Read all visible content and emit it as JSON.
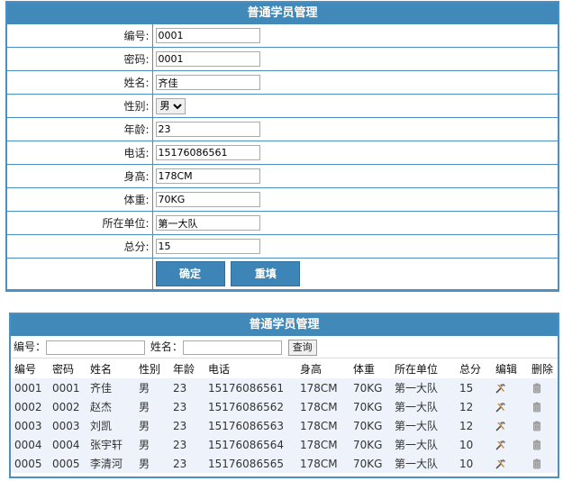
{
  "form": {
    "title": "普通学员管理",
    "fields": [
      {
        "label": "编号:",
        "value": "0001"
      },
      {
        "label": "密码:",
        "value": "0001"
      },
      {
        "label": "姓名:",
        "value": "齐佳"
      },
      {
        "label": "性别:",
        "value": "男"
      },
      {
        "label": "年龄:",
        "value": "23"
      },
      {
        "label": "电话:",
        "value": "15176086561"
      },
      {
        "label": "身高:",
        "value": "178CM"
      },
      {
        "label": "体重:",
        "value": "70KG"
      },
      {
        "label": "所在单位:",
        "value": "第一大队"
      },
      {
        "label": "总分:",
        "value": "15"
      }
    ],
    "confirm_label": "确定",
    "reset_label": "重填"
  },
  "list": {
    "title": "普通学员管理",
    "search": {
      "id_label": "编号：",
      "name_label": "姓名：",
      "query_label": "查询"
    },
    "columns": [
      "编号",
      "密码",
      "姓名",
      "性别",
      "年龄",
      "电话",
      "身高",
      "体重",
      "所在单位",
      "总分",
      "编辑",
      "删除"
    ],
    "rows": [
      [
        "0001",
        "0001",
        "齐佳",
        "男",
        "23",
        "15176086561",
        "178CM",
        "70KG",
        "第一大队",
        "15"
      ],
      [
        "0002",
        "0002",
        "赵杰",
        "男",
        "23",
        "15176086562",
        "178CM",
        "70KG",
        "第一大队",
        "12"
      ],
      [
        "0003",
        "0003",
        "刘凯",
        "男",
        "23",
        "15176086563",
        "178CM",
        "70KG",
        "第一大队",
        "12"
      ],
      [
        "0004",
        "0004",
        "张宇轩",
        "男",
        "23",
        "15176086564",
        "178CM",
        "70KG",
        "第一大队",
        "10"
      ],
      [
        "0005",
        "0005",
        "李清河",
        "男",
        "23",
        "15176086565",
        "178CM",
        "70KG",
        "第一大队",
        "10"
      ]
    ],
    "edit_icon": "edit-tools-icon",
    "delete_icon": "trash-icon"
  },
  "colors": {
    "header": "#4189b8",
    "border": "#4a90c2",
    "row_bg": "#eef3fb"
  }
}
